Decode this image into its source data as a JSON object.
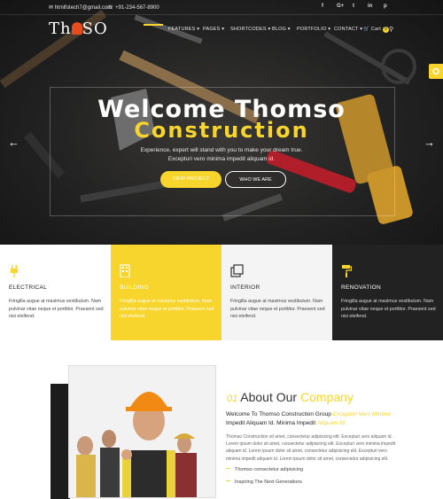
{
  "topbar": {
    "email": "htmlfotech7@gmail.com",
    "phone": "+91-234-567-8900",
    "social": [
      "f",
      "G+",
      "t",
      "in",
      "p"
    ]
  },
  "brand": {
    "logo_text_left": "Th",
    "logo_text_right": "SO"
  },
  "nav": {
    "items": [
      "FEATURES ▾",
      "PAGES ▾",
      "SHORTCODES ▾",
      "BLOG ▾",
      "PORTFOLIO ▾",
      "CONTACT ▾"
    ],
    "cart_label": "Cart",
    "cart_count": "0"
  },
  "hero": {
    "title": "Welcome Thomso",
    "subtitle": "Construction",
    "text_line1": "Experience, expert will stand with you to make your dream true.",
    "text_line2": "Excepturi vero minima impedit aliquam id.",
    "btn_project": "VIEW PROJECT",
    "btn_who": "WHO WE ARE"
  },
  "services": [
    {
      "title": "ELECTRICAL",
      "text": "Fringilla augue at maximus vestibulum. Nam pulvinar vitae neque et porttitor. Praesent sed nisi eleifend."
    },
    {
      "title": "BUILDING",
      "text": "Fringilla augue at maximus vestibulum. Nam pulvinar vitae neque et porttitor. Praesent sed nisi eleifend."
    },
    {
      "title": "INTERIOR",
      "text": "Fringilla augue at maximus vestibulum. Nam pulvinar vitae neque et porttitor. Praesent sed nisi eleifend."
    },
    {
      "title": "RENOVATION",
      "text": "Fringilla augue at maximus vestibulum. Nam pulvinar vitae neque et porttitor. Praesent sed nisi eleifend."
    }
  ],
  "about": {
    "number": "01",
    "heading_plain": "About Our",
    "heading_accent": "Company",
    "lead_plain1": "Welcome To Thomso Construction Group",
    "lead_accent1": "Excepturi Vero Minima",
    "lead_plain2": "Impedit Aliquam Id. Minima Impedit",
    "lead_accent2": "Aliquam Id.",
    "body": "Thomso Construction sit amet, consectetur adipisicing elit. Excepturi vero aliquam id. Lorem ipsum dolor sit amet, consectetur adipisicing elit. Excepturi vero minima impedit aliquam id. Lorem ipsum dolor sit amet, consectetur adipisicing elit. Excepturi vero minima impedit aliquam id. Lorem ipsum dolor sit amet, consectetur adipisicing elit.",
    "bullets": [
      "Thomso consectetur adipisicing",
      "Inspiring The Next Generations"
    ]
  },
  "colors": {
    "accent": "#f8d52c",
    "dark": "#222222",
    "light": "#f4f4f4"
  }
}
